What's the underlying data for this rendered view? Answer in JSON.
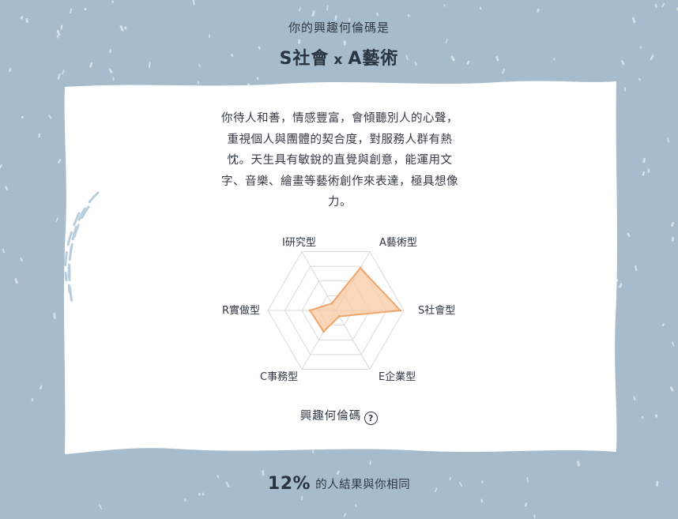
{
  "header": {
    "subtitle": "你的興趣何倫碼是",
    "code_left": "S社會",
    "code_sep": "x",
    "code_right": "A藝術"
  },
  "card": {
    "description": "你待人和善，情感豐富，會傾聽別人的心聲，重視個人與團體的契合度，對服務人群有熱忱。天生具有敏銳的直覺與創意，能運用文字、音樂、繪畫等藝術創作來表達，極具想像力。"
  },
  "chart_data": {
    "type": "radar",
    "axes": [
      "I研究型",
      "A藝術型",
      "S社會型",
      "E企業型",
      "C事務型",
      "R實做型"
    ],
    "values": [
      0.12,
      0.72,
      0.95,
      0.1,
      0.36,
      0.38
    ],
    "range": [
      0,
      1
    ],
    "fill_color": "#f9c9a3",
    "stroke_color": "#f0a56b",
    "grid_color": "#d9d9d9"
  },
  "code_label": {
    "text": "興趣何倫碼",
    "icon": "question-circle-icon"
  },
  "footer": {
    "percent": "12%",
    "text": "的人結果與你相同"
  },
  "colors": {
    "background": "#a6bccd",
    "card": "#ffffff",
    "text": "#2e3742"
  }
}
